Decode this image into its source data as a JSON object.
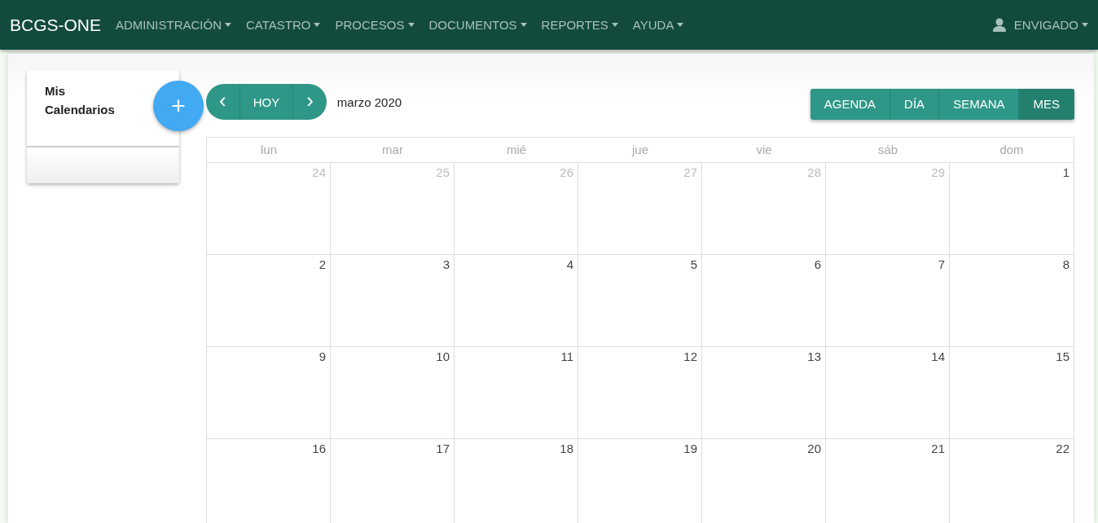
{
  "navbar": {
    "brand": "BCGS-ONE",
    "menus": [
      {
        "label": "ADMINISTRACIÓN"
      },
      {
        "label": "CATASTRO"
      },
      {
        "label": "PROCESOS"
      },
      {
        "label": "DOCUMENTOS"
      },
      {
        "label": "REPORTES"
      },
      {
        "label": "AYUDA"
      }
    ],
    "user": "ENVIGADO"
  },
  "sidebar": {
    "title": "Mis Calendarios",
    "add_button": "+"
  },
  "toolbar": {
    "prev": "‹",
    "today": "HOY",
    "next": "›",
    "period": "marzo 2020",
    "views": [
      {
        "label": "AGENDA",
        "selected": false
      },
      {
        "label": "DÍA",
        "selected": false
      },
      {
        "label": "SEMANA",
        "selected": false
      },
      {
        "label": "MES",
        "selected": true
      }
    ]
  },
  "calendar": {
    "weekdays": [
      "lun",
      "mar",
      "mié",
      "jue",
      "vie",
      "sáb",
      "dom"
    ],
    "weeks": [
      [
        {
          "day": "24",
          "other_month": true
        },
        {
          "day": "25",
          "other_month": true
        },
        {
          "day": "26",
          "other_month": true
        },
        {
          "day": "27",
          "other_month": true
        },
        {
          "day": "28",
          "other_month": true
        },
        {
          "day": "29",
          "other_month": true
        },
        {
          "day": "1",
          "other_month": false
        }
      ],
      [
        {
          "day": "2",
          "other_month": false
        },
        {
          "day": "3",
          "other_month": false
        },
        {
          "day": "4",
          "other_month": false
        },
        {
          "day": "5",
          "other_month": false
        },
        {
          "day": "6",
          "other_month": false
        },
        {
          "day": "7",
          "other_month": false
        },
        {
          "day": "8",
          "other_month": false
        }
      ],
      [
        {
          "day": "9",
          "other_month": false
        },
        {
          "day": "10",
          "other_month": false
        },
        {
          "day": "11",
          "other_month": false
        },
        {
          "day": "12",
          "other_month": false
        },
        {
          "day": "13",
          "other_month": false
        },
        {
          "day": "14",
          "other_month": false
        },
        {
          "day": "15",
          "other_month": false
        }
      ],
      [
        {
          "day": "16",
          "other_month": false
        },
        {
          "day": "17",
          "other_month": false
        },
        {
          "day": "18",
          "other_month": false
        },
        {
          "day": "19",
          "other_month": false
        },
        {
          "day": "20",
          "other_month": false
        },
        {
          "day": "21",
          "other_month": false
        },
        {
          "day": "22",
          "other_month": false
        }
      ]
    ]
  }
}
